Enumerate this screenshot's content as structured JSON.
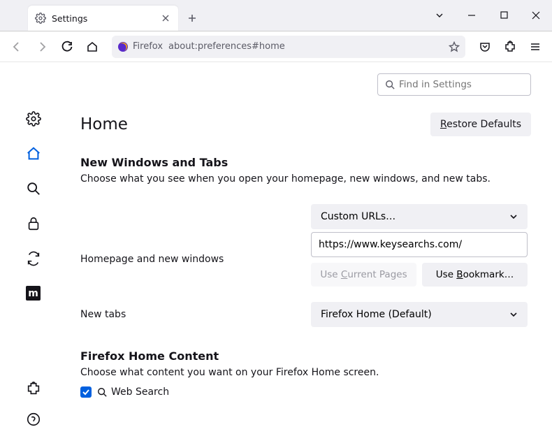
{
  "titlebar": {
    "tab_title": "Settings"
  },
  "urlbar": {
    "label": "Firefox",
    "url": "about:preferences#home"
  },
  "search": {
    "placeholder": "Find in Settings"
  },
  "page": {
    "title": "Home",
    "restore_btn": "Restore Defaults"
  },
  "section1": {
    "heading": "New Windows and Tabs",
    "desc": "Choose what you see when you open your homepage, new windows, and new tabs.",
    "homepage_label": "Homepage and new windows",
    "homepage_select": "Custom URLs…",
    "homepage_url": "https://www.keysearchs.com/",
    "use_current": "Use Current Pages",
    "use_bookmark": "Use Bookmark…",
    "newtabs_label": "New tabs",
    "newtabs_select": "Firefox Home (Default)"
  },
  "section2": {
    "heading": "Firefox Home Content",
    "desc": "Choose what content you want on your Firefox Home screen.",
    "websearch": "Web Search"
  }
}
